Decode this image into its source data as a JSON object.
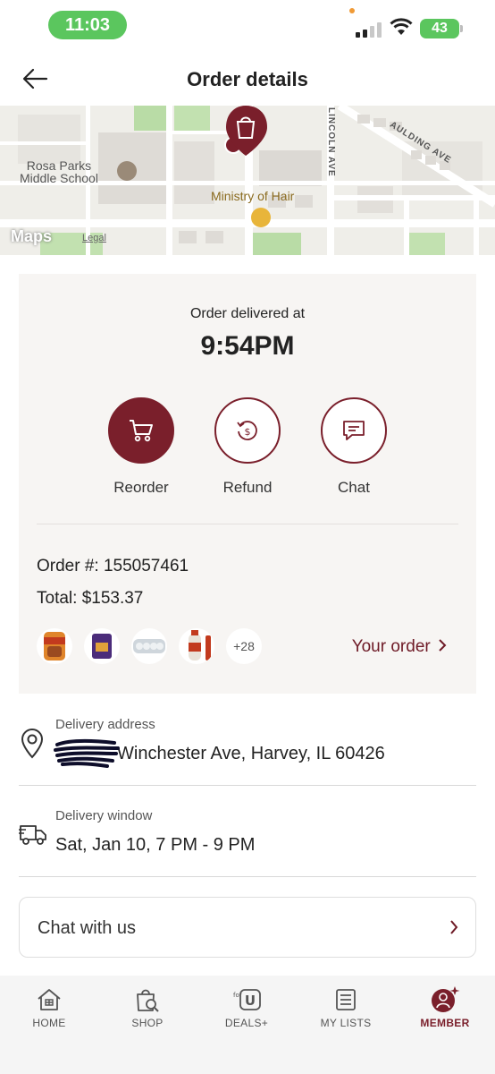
{
  "status_bar": {
    "time": "11:03",
    "battery": "43"
  },
  "header": {
    "title": "Order details",
    "back_icon": "arrow-left-icon"
  },
  "map": {
    "labels": {
      "school": "Rosa Parks\nMiddle School",
      "business": "Ministry of Hair",
      "street_lincoln": "LINCOLN AVE",
      "street_spaulding": "AULDING AVE"
    },
    "attribution": {
      "logo": "Maps",
      "legal": "Legal"
    }
  },
  "order": {
    "delivered_label": "Order delivered at",
    "delivered_time": "9:54PM",
    "actions": [
      {
        "label": "Reorder",
        "icon": "cart-icon",
        "primary": true
      },
      {
        "label": "Refund",
        "icon": "refund-icon",
        "primary": false
      },
      {
        "label": "Chat",
        "icon": "chat-bubble-icon",
        "primary": false
      }
    ],
    "order_number_label": "Order #: 155057461",
    "total_label": "Total: $153.37",
    "more_items": "+28",
    "your_order_label": "Your order"
  },
  "delivery": {
    "address_label": "Delivery address",
    "address_value": "Winchester Ave, Harvey, IL 60426",
    "window_label": "Delivery window",
    "window_value": "Sat, Jan 10,  7 PM - 9 PM"
  },
  "chat": {
    "label": "Chat with us"
  },
  "nav": {
    "items": [
      {
        "label": "HOME",
        "icon": "home-icon"
      },
      {
        "label": "SHOP",
        "icon": "shop-bag-icon"
      },
      {
        "label": "DEALS+",
        "icon": "deals-icon"
      },
      {
        "label": "MY LISTS",
        "icon": "list-icon"
      },
      {
        "label": "MEMBER",
        "icon": "member-icon",
        "active": true
      }
    ]
  },
  "colors": {
    "brand": "#7a1f2b",
    "status_green": "#5bc65e"
  }
}
